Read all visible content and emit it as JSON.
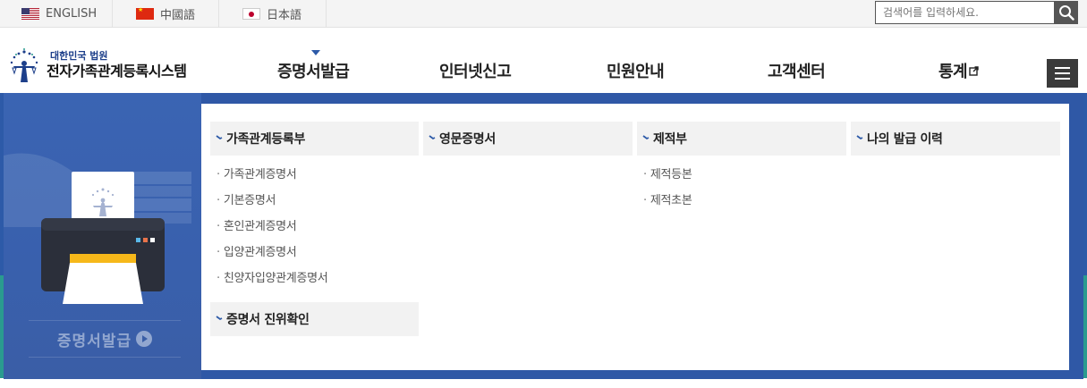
{
  "languages": [
    {
      "label": "ENGLISH",
      "flag": "us-flag-icon"
    },
    {
      "label": "中國語",
      "flag": "cn-flag-icon"
    },
    {
      "label": "日本語",
      "flag": "jp-flag-icon"
    }
  ],
  "search": {
    "placeholder": "검색어를 입력하세요.",
    "button_icon": "search-icon"
  },
  "logo": {
    "subtitle": "대한민국 법원",
    "title": "전자가족관계등록시스템"
  },
  "nav": [
    {
      "label": "증명서발급",
      "active": true
    },
    {
      "label": "인터넷신고"
    },
    {
      "label": "민원안내"
    },
    {
      "label": "고객센터"
    },
    {
      "label": "통계",
      "external": true
    }
  ],
  "menu_button_icon": "hamburger-menu-icon",
  "illustration": {
    "caption": "증명서발급",
    "icon": "play-circle-icon"
  },
  "mega_menu": {
    "columns": [
      {
        "title": "가족관계등록부",
        "links": [
          "가족관계증명서",
          "기본증명서",
          "혼인관계증명서",
          "입양관계증명서",
          "친양자입양관계증명서"
        ]
      },
      {
        "title": "영문증명서",
        "links": []
      },
      {
        "title": "제적부",
        "links": [
          "제적등본",
          "제적초본"
        ]
      },
      {
        "title": "나의 발급 이력",
        "links": []
      }
    ],
    "extra": {
      "title": "증명서 진위확인"
    }
  },
  "colors": {
    "nav_blue": "#2d5aa8",
    "teal": "#2a9b8f",
    "dark_button": "#3a3a3a",
    "category_bg": "#f2f2f2"
  }
}
